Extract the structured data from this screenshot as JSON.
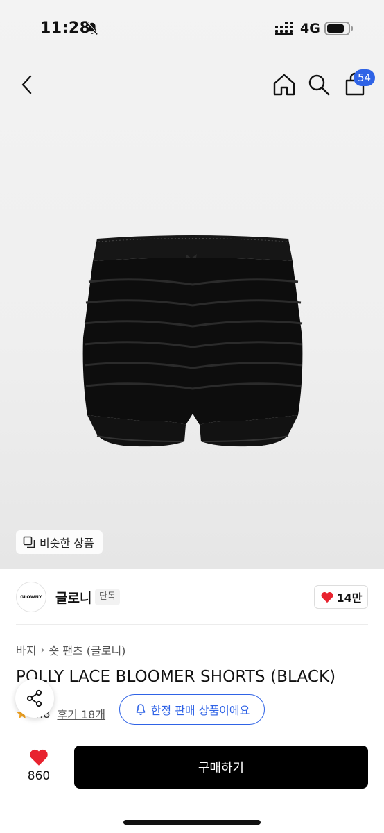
{
  "status_bar": {
    "time": "11:28",
    "network": "4G"
  },
  "nav": {
    "cart_count": "54"
  },
  "product": {
    "similar_label": "비슷한 상품",
    "brand_name": "글로니",
    "brand_logo_text": "GLOWNY",
    "brand_tag": "단독",
    "brand_likes": "14만",
    "breadcrumb": [
      "바지",
      "숏 팬츠 (글로니)"
    ],
    "title": "POLLY LACE BLOOMER SHORTS (BLACK)",
    "rating": "4.8",
    "review_label": "후기 18개",
    "limited_label": "한정 판매 상품이에요"
  },
  "bottom_bar": {
    "like_count": "860",
    "buy_label": "구매하기"
  },
  "colors": {
    "accent": "#2f63e6",
    "heart": "#e8232f",
    "star": "#f5a623",
    "buy_button": "#000000"
  },
  "icons": [
    "bell-slash-icon",
    "signal-icon",
    "battery-icon",
    "back-chevron-icon",
    "home-icon",
    "search-icon",
    "cart-icon",
    "copy-icon",
    "heart-icon",
    "star-icon",
    "share-icon",
    "bell-icon"
  ]
}
